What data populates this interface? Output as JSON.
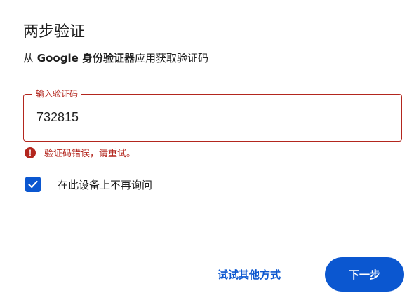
{
  "header": {
    "title": "两步验证",
    "subtitle_prefix": "从 ",
    "subtitle_app": "Google 身份验证器",
    "subtitle_suffix": "应用获取验证码"
  },
  "code_field": {
    "label": "输入验证码",
    "value": "732815"
  },
  "error": {
    "icon": "error-icon",
    "message": "验证码错误，请重试。"
  },
  "remember": {
    "checked": true,
    "label": "在此设备上不再询问"
  },
  "actions": {
    "try_other_label": "试试其他方式",
    "next_label": "下一步"
  },
  "colors": {
    "primary": "#0b57d0",
    "error": "#b3261e"
  }
}
